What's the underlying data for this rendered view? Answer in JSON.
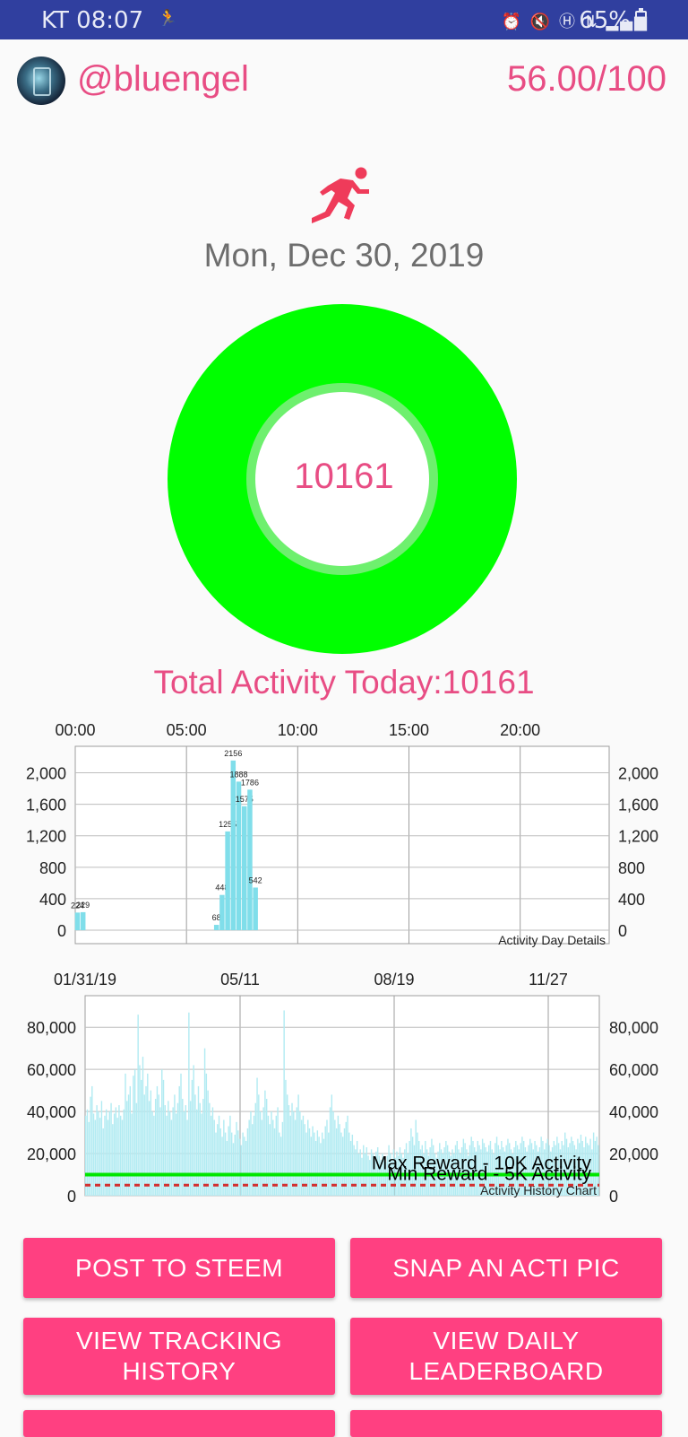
{
  "status_bar": {
    "time": "KT 08:07",
    "battery": "65%",
    "icons": [
      "alarm-icon",
      "mute-icon",
      "hd-icon",
      "lte-icon",
      "signal-icon"
    ]
  },
  "header": {
    "username": "@bluengel",
    "score": "56.00/100"
  },
  "date": "Mon, Dec 30, 2019",
  "ring": {
    "value": "10161",
    "progress": 1.0,
    "ring_color": "#00ff00"
  },
  "total_activity": "Total Activity Today:10161",
  "colors": {
    "accent": "#e84d84",
    "button": "#ff4081",
    "bar": "#80deea",
    "max_line": "#00e600",
    "min_line": "#d32f2f"
  },
  "chart_data": [
    {
      "type": "bar",
      "title": "Activity Day Details",
      "x_tick_labels": [
        "00:00",
        "05:00",
        "10:00",
        "15:00",
        "20:00"
      ],
      "y_tick_labels": [
        "0",
        "400",
        "800",
        "1,200",
        "1,600",
        "2,000"
      ],
      "ylim": [
        0,
        2300
      ],
      "xlim_hours": [
        0,
        24
      ],
      "grid": true,
      "bars": [
        {
          "hour": 0.1,
          "value": 224,
          "label": "224"
        },
        {
          "hour": 0.35,
          "value": 229,
          "label": "229"
        },
        {
          "hour": 6.35,
          "value": 68,
          "label": "68"
        },
        {
          "hour": 6.6,
          "value": 448,
          "label": "448"
        },
        {
          "hour": 6.85,
          "value": 1255,
          "label": "1255"
        },
        {
          "hour": 7.1,
          "value": 2156,
          "label": "2156"
        },
        {
          "hour": 7.35,
          "value": 1888,
          "label": "1888"
        },
        {
          "hour": 7.6,
          "value": 1575,
          "label": "1575"
        },
        {
          "hour": 7.85,
          "value": 1786,
          "label": "1786"
        },
        {
          "hour": 8.1,
          "value": 542,
          "label": "542"
        }
      ]
    },
    {
      "type": "bar",
      "title": "Activity History Chart",
      "x_tick_labels": [
        "01/31/19",
        "05/11",
        "08/19",
        "11/27"
      ],
      "y_tick_labels": [
        "0",
        "20,000",
        "40,000",
        "60,000",
        "80,000"
      ],
      "ylim": [
        0,
        95000
      ],
      "grid": true,
      "reference_lines": [
        {
          "name": "Max Reward - 10K Activity",
          "value": 10000
        },
        {
          "name": "Min Reward - 5K Activity",
          "value": 5000
        }
      ],
      "daily_values_note": "approximately 335 daily values from 01/31/19 to 12/30/19",
      "values": [
        38000,
        41000,
        35000,
        47000,
        52000,
        39000,
        36000,
        43000,
        40000,
        37000,
        45000,
        32000,
        38000,
        41000,
        36000,
        40000,
        44000,
        34000,
        39000,
        42000,
        37000,
        43000,
        38000,
        36000,
        41000,
        58000,
        45000,
        48000,
        52000,
        39000,
        57000,
        60000,
        44000,
        86000,
        62000,
        55000,
        66000,
        48000,
        52000,
        58000,
        45000,
        50000,
        40000,
        38000,
        46000,
        52000,
        48000,
        42000,
        60000,
        55000,
        43000,
        38000,
        45000,
        40000,
        36000,
        42000,
        48000,
        39000,
        44000,
        52000,
        58000,
        46000,
        40000,
        43000,
        36000,
        87000,
        45000,
        55000,
        62000,
        48000,
        41000,
        52000,
        44000,
        39000,
        46000,
        70000,
        58000,
        50000,
        44000,
        38000,
        42000,
        36000,
        30000,
        34000,
        38000,
        32000,
        28000,
        36000,
        30000,
        26000,
        33000,
        38000,
        30000,
        25000,
        29000,
        35000,
        31000,
        27000,
        24000,
        30000,
        28000,
        26000,
        32000,
        36000,
        40000,
        34000,
        38000,
        44000,
        56000,
        48000,
        40000,
        36000,
        42000,
        50000,
        46000,
        38000,
        34000,
        40000,
        36000,
        32000,
        38000,
        42000,
        30000,
        28000,
        35000,
        88000,
        55000,
        48000,
        43000,
        38000,
        44000,
        40000,
        36000,
        42000,
        48000,
        40000,
        36000,
        38000,
        34000,
        30000,
        36000,
        32000,
        28000,
        33000,
        30000,
        26000,
        31000,
        28000,
        25000,
        30000,
        27000,
        33000,
        36000,
        30000,
        42000,
        48000,
        40000,
        36000,
        32000,
        38000,
        34000,
        30000,
        28000,
        32000,
        35000,
        38000,
        30000,
        26000,
        29000,
        24000,
        22000,
        26000,
        20000,
        22000,
        18000,
        24000,
        20000,
        23000,
        19000,
        17000,
        22000,
        20000,
        18000,
        21000,
        23000,
        19000,
        17000,
        20000,
        18000,
        16000,
        19000,
        24000,
        20000,
        17000,
        22000,
        18000,
        21000,
        19000,
        23000,
        20000,
        18000,
        22000,
        25000,
        20000,
        26000,
        32000,
        28000,
        24000,
        36000,
        30000,
        26000,
        22000,
        24000,
        20000,
        26000,
        22000,
        19000,
        23000,
        27000,
        24000,
        20000,
        18000,
        21000,
        25000,
        22000,
        20000,
        23000,
        26000,
        24000,
        21000,
        19000,
        22000,
        20000,
        24000,
        26000,
        22000,
        20000,
        23000,
        27000,
        25000,
        22000,
        19000,
        24000,
        28000,
        26000,
        23000,
        21000,
        26000,
        24000,
        22000,
        27000,
        25000,
        23000,
        21000,
        24000,
        26000,
        22000,
        20000,
        25000,
        28000,
        24000,
        22000,
        26000,
        23000,
        21000,
        24000,
        27000,
        25000,
        22000,
        20000,
        23000,
        26000,
        24000,
        22000,
        25000,
        28000,
        26000,
        23000,
        21000,
        24000,
        27000,
        25000,
        22000,
        26000,
        24000,
        21000,
        23000,
        28000,
        26000,
        22000,
        25000,
        27000,
        24000,
        21000,
        23000,
        26000,
        24000,
        28000,
        25000,
        22000,
        26000,
        24000,
        30000,
        27000,
        23000,
        25000,
        28000,
        26000,
        24000,
        22000,
        27000,
        25000,
        29000,
        26000,
        23000,
        28000,
        25000,
        24000,
        27000,
        22000,
        30000,
        26000,
        28000,
        24000
      ]
    }
  ],
  "buttons": [
    {
      "id": "post",
      "label": "POST TO STEEM"
    },
    {
      "id": "snap",
      "label": "SNAP AN ACTI PIC"
    },
    {
      "id": "history",
      "line1": "VIEW TRACKING",
      "line2": "HISTORY"
    },
    {
      "id": "leaderboard",
      "line1": "VIEW DAILY",
      "line2": "LEADERBOARD"
    }
  ]
}
